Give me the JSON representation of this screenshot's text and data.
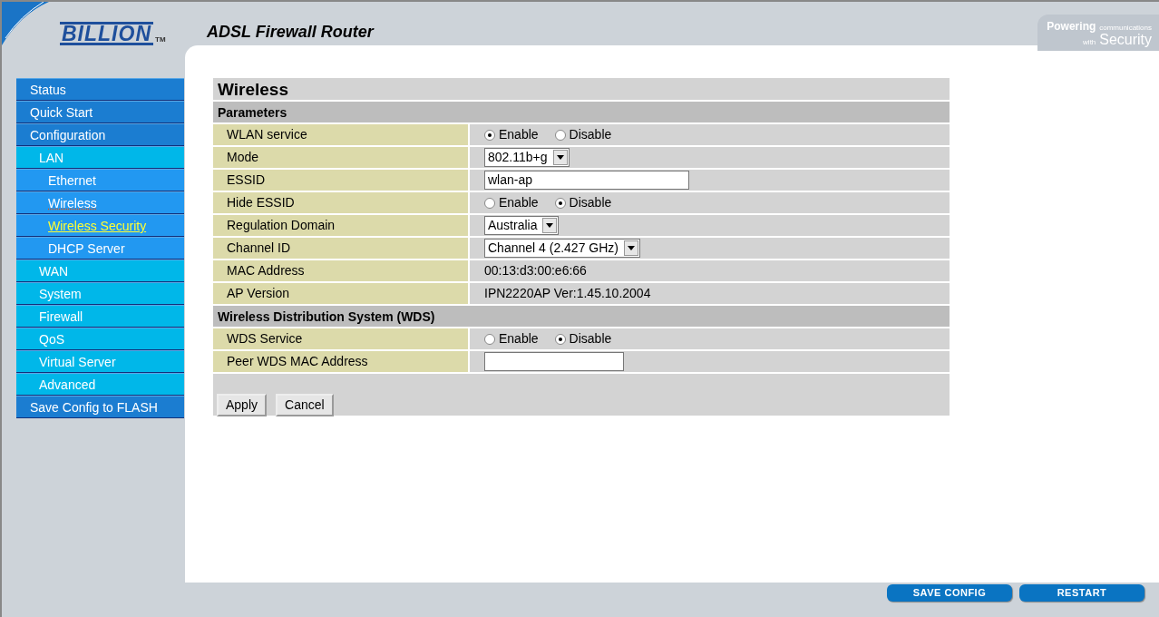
{
  "header": {
    "brand": "BILLION",
    "trademark": "TM",
    "title": "ADSL Firewall Router",
    "tagline_bold": "Powering",
    "tagline_small": "communications",
    "tagline_with": "with",
    "tagline_big": "Security"
  },
  "sidebar": {
    "items": [
      {
        "label": "Status",
        "selected": false,
        "focused": false
      },
      {
        "label": "Quick Start",
        "selected": false,
        "focused": false
      },
      {
        "label": "Configuration",
        "selected": false,
        "focused": false,
        "children": [
          {
            "label": "LAN",
            "selected": false,
            "focused": false,
            "children": [
              {
                "label": "Ethernet",
                "selected": false,
                "focused": false
              },
              {
                "label": "Wireless",
                "selected": false,
                "focused": true
              },
              {
                "label": "Wireless Security",
                "selected": true,
                "focused": false
              },
              {
                "label": "DHCP Server",
                "selected": false,
                "focused": false
              }
            ]
          },
          {
            "label": "WAN",
            "selected": false,
            "focused": false
          },
          {
            "label": "System",
            "selected": false,
            "focused": false
          },
          {
            "label": "Firewall",
            "selected": false,
            "focused": false
          },
          {
            "label": "QoS",
            "selected": false,
            "focused": false
          },
          {
            "label": "Virtual Server",
            "selected": false,
            "focused": false
          },
          {
            "label": "Advanced",
            "selected": false,
            "focused": false
          }
        ]
      },
      {
        "label": "Save Config to FLASH",
        "selected": false,
        "focused": false
      }
    ]
  },
  "form": {
    "title": "Wireless",
    "sections": [
      {
        "heading": "Parameters",
        "rows": [
          {
            "label": "WLAN service",
            "kind": "radio",
            "options": [
              {
                "label": "Enable",
                "selected": true
              },
              {
                "label": "Disable",
                "selected": false
              }
            ]
          },
          {
            "label": "Mode",
            "kind": "select",
            "value": "802.11b+g"
          },
          {
            "label": "ESSID",
            "kind": "text",
            "value": "wlan-ap"
          },
          {
            "label": "Hide ESSID",
            "kind": "radio",
            "options": [
              {
                "label": "Enable",
                "selected": false
              },
              {
                "label": "Disable",
                "selected": true
              }
            ]
          },
          {
            "label": "Regulation Domain",
            "kind": "select",
            "value": "Australia"
          },
          {
            "label": "Channel ID",
            "kind": "select",
            "value": "Channel 4 (2.427 GHz)"
          },
          {
            "label": "MAC Address",
            "kind": "static",
            "value": "00:13:d3:00:e6:66"
          },
          {
            "label": "AP Version",
            "kind": "static",
            "value": "IPN2220AP Ver:1.45.10.2004"
          }
        ]
      },
      {
        "heading": "Wireless Distribution System (WDS)",
        "rows": [
          {
            "label": "WDS Service",
            "kind": "radio",
            "options": [
              {
                "label": "Enable",
                "selected": false
              },
              {
                "label": "Disable",
                "selected": true
              }
            ]
          },
          {
            "label": "Peer WDS MAC Address",
            "kind": "text",
            "value": ""
          }
        ]
      }
    ],
    "buttons": [
      "Apply",
      "Cancel"
    ]
  },
  "footer_buttons": [
    "SAVE CONFIG",
    "RESTART"
  ]
}
